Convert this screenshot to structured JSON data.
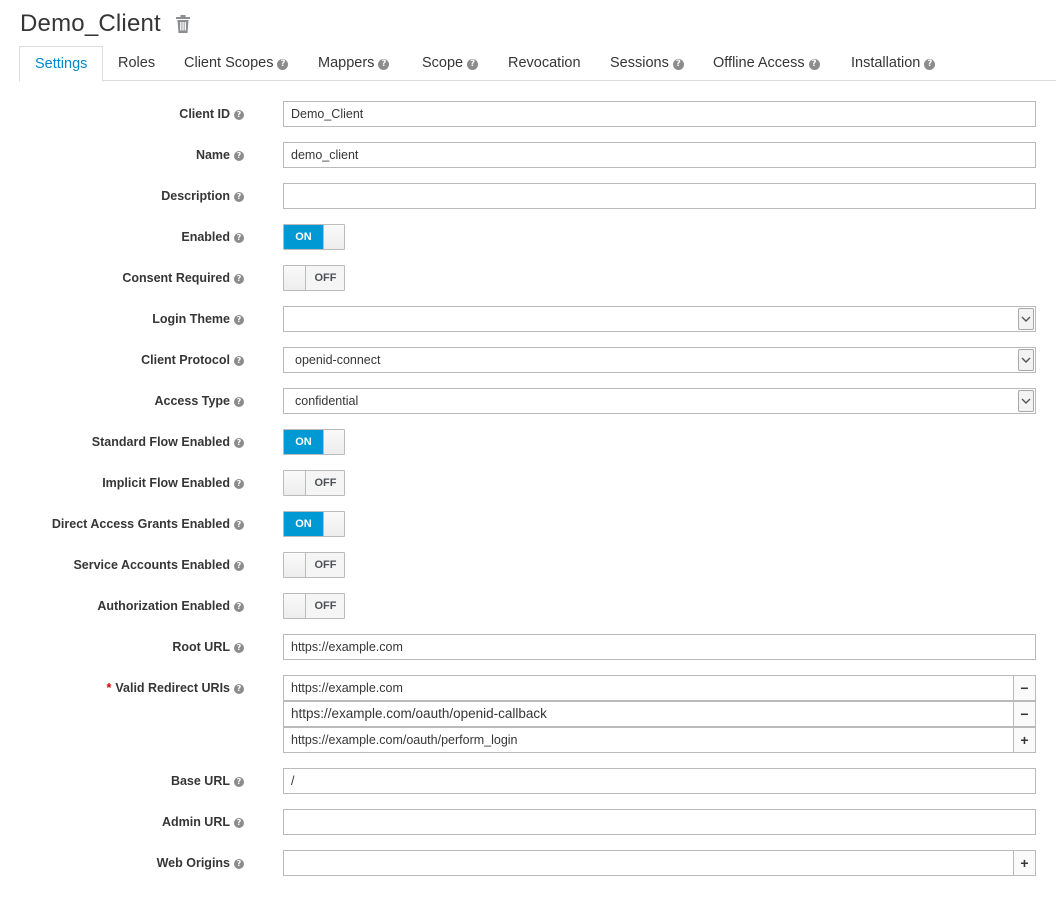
{
  "header": {
    "title": "Demo_Client"
  },
  "tabs": [
    {
      "label": "Settings",
      "help": false,
      "active": true
    },
    {
      "label": "Roles",
      "help": false
    },
    {
      "label": "Client Scopes",
      "help": true
    },
    {
      "label": "Mappers",
      "help": true
    },
    {
      "label": "Scope",
      "help": true
    },
    {
      "label": "Revocation",
      "help": false
    },
    {
      "label": "Sessions",
      "help": true
    },
    {
      "label": "Offline Access",
      "help": true
    },
    {
      "label": "Installation",
      "help": true
    }
  ],
  "form": {
    "client_id": {
      "label": "Client ID",
      "value": "Demo_Client"
    },
    "name": {
      "label": "Name",
      "value": "demo_client"
    },
    "description": {
      "label": "Description",
      "value": ""
    },
    "enabled": {
      "label": "Enabled",
      "state": "ON"
    },
    "consent_required": {
      "label": "Consent Required",
      "state": "OFF"
    },
    "login_theme": {
      "label": "Login Theme",
      "value": ""
    },
    "client_protocol": {
      "label": "Client Protocol",
      "value": "openid-connect"
    },
    "access_type": {
      "label": "Access Type",
      "value": "confidential"
    },
    "standard_flow": {
      "label": "Standard Flow Enabled",
      "state": "ON"
    },
    "implicit_flow": {
      "label": "Implicit Flow Enabled",
      "state": "OFF"
    },
    "direct_access": {
      "label": "Direct Access Grants Enabled",
      "state": "ON"
    },
    "service_accounts": {
      "label": "Service Accounts Enabled",
      "state": "OFF"
    },
    "authorization": {
      "label": "Authorization Enabled",
      "state": "OFF"
    },
    "root_url": {
      "label": "Root URL",
      "value": "https://example.com"
    },
    "valid_redirect_uris": {
      "required_mark": "*",
      "label": "Valid Redirect URIs",
      "values": [
        "https://example.com",
        "https://example.com/oauth/openid-callback",
        "https://example.com/oauth/perform_login"
      ],
      "remove_symbol": "−",
      "add_symbol": "+"
    },
    "base_url": {
      "label": "Base URL",
      "value": "/"
    },
    "admin_url": {
      "label": "Admin URL",
      "value": ""
    },
    "web_origins": {
      "label": "Web Origins",
      "value": "",
      "add_symbol": "+"
    }
  },
  "help_glyph": "?",
  "icons": {
    "delete": "trash-icon",
    "help": "question-circle-icon",
    "dropdown": "chevron-down-icon"
  },
  "colors": {
    "accent": "#0088ce",
    "toggle_on": "#0099d3",
    "required": "#cc0000"
  }
}
